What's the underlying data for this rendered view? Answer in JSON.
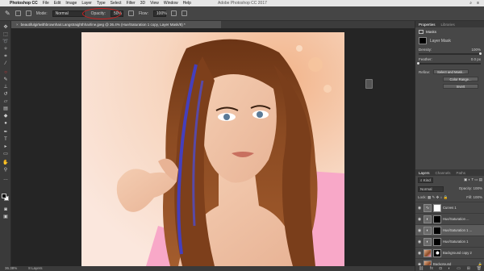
{
  "menubar": {
    "app_name": "Photoshop CC",
    "items": [
      "File",
      "Edit",
      "Image",
      "Layer",
      "Type",
      "Select",
      "Filter",
      "3D",
      "View",
      "Window",
      "Help"
    ],
    "window_title": "Adobe Photoshop CC 2017"
  },
  "options": {
    "mode_label": "Mode:",
    "mode_value": "Normal",
    "opacity_label": "Opacity:",
    "opacity_value": "50%",
    "flow_label": "Flow:",
    "flow_value": "100%",
    "highlight_color": "#c62020"
  },
  "document": {
    "tab_title": "beautifulgirlwithbrownhair.Langstraighthhairline.jpeg @ 36.4% (Hue/Saturation 1 copy, Layer Mask/8) *"
  },
  "status": {
    "zoom": "36.38%",
    "info": "8 Layers"
  },
  "properties": {
    "tabs": [
      "Properties",
      "Libraries"
    ],
    "section": "Masks",
    "layer_mask_label": "Layer Mask",
    "density_label": "Density:",
    "density_value": "100%",
    "density_level": 1.0,
    "feather_label": "Feather:",
    "feather_value": "0.0 px",
    "feather_level": 0.0,
    "refine_label": "Refine:",
    "select_mask_label": "Select and Mask...",
    "color_range_label": "Color Range...",
    "invert_label": "Invert"
  },
  "layers_panel": {
    "tabs": [
      "Layers",
      "Channels",
      "Paths"
    ],
    "kind_label": "Kind",
    "blend_mode": "Normal",
    "opacity_label": "Opacity:",
    "opacity_value": "100%",
    "lock_label": "Lock:",
    "fill_label": "Fill:",
    "fill_value": "100%",
    "layers": [
      {
        "name": "Curves 1",
        "selected": false
      },
      {
        "name": "Hue/Saturation ...",
        "selected": false
      },
      {
        "name": "Hue/Saturation 1 ...",
        "selected": true
      },
      {
        "name": "Hue/Saturation 1",
        "selected": false
      },
      {
        "name": "Background copy 2",
        "selected": false
      },
      {
        "name": "Background",
        "selected": false
      }
    ]
  },
  "colors": {
    "canvas_bg": "#252525",
    "panel_bg": "#474747",
    "accent_pink": "#f8a8c8"
  }
}
